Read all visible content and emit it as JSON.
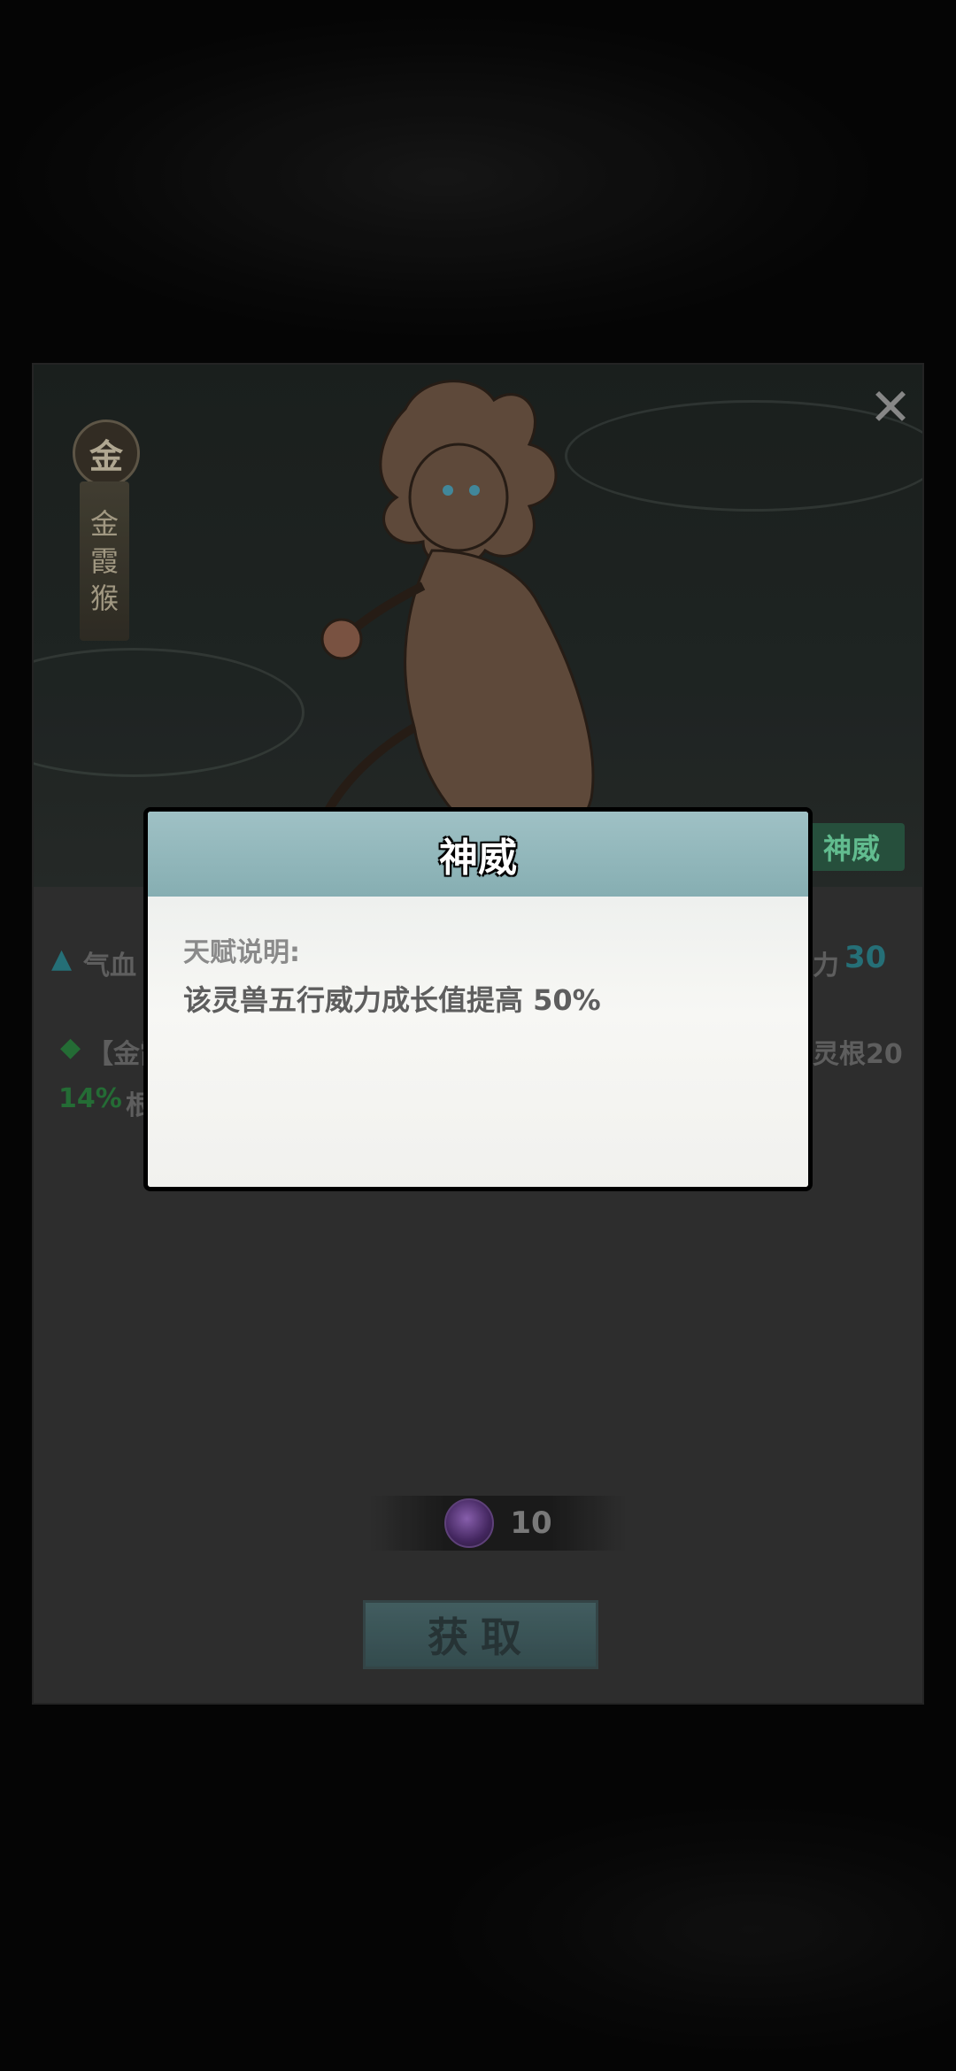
{
  "pet_card": {
    "element_badge": "金",
    "name_chars": [
      "金",
      "霞",
      "猴"
    ],
    "talent_button_label": "神威",
    "stats_peek": {
      "left_stat_label": "气血",
      "right_stat_partial": "力",
      "right_stat_value": "30",
      "bonus_bracket_partial": "【金霞",
      "bonus_right_partial": "灵根20",
      "percent_value": "14%",
      "percent_suffix_partial": "根"
    },
    "cost": {
      "amount": "10",
      "gem_icon": "purple-orb-icon"
    },
    "obtain_button_label": "获取"
  },
  "modal": {
    "title": "神威",
    "label": "天赋说明:",
    "description": "该灵兽五行威力成长值提高 50%"
  },
  "colors": {
    "overlay": "#000000",
    "header_teal": "#9fc1c5",
    "talent_green": "#6fd7a3",
    "stat_teal": "#2b7f88"
  }
}
